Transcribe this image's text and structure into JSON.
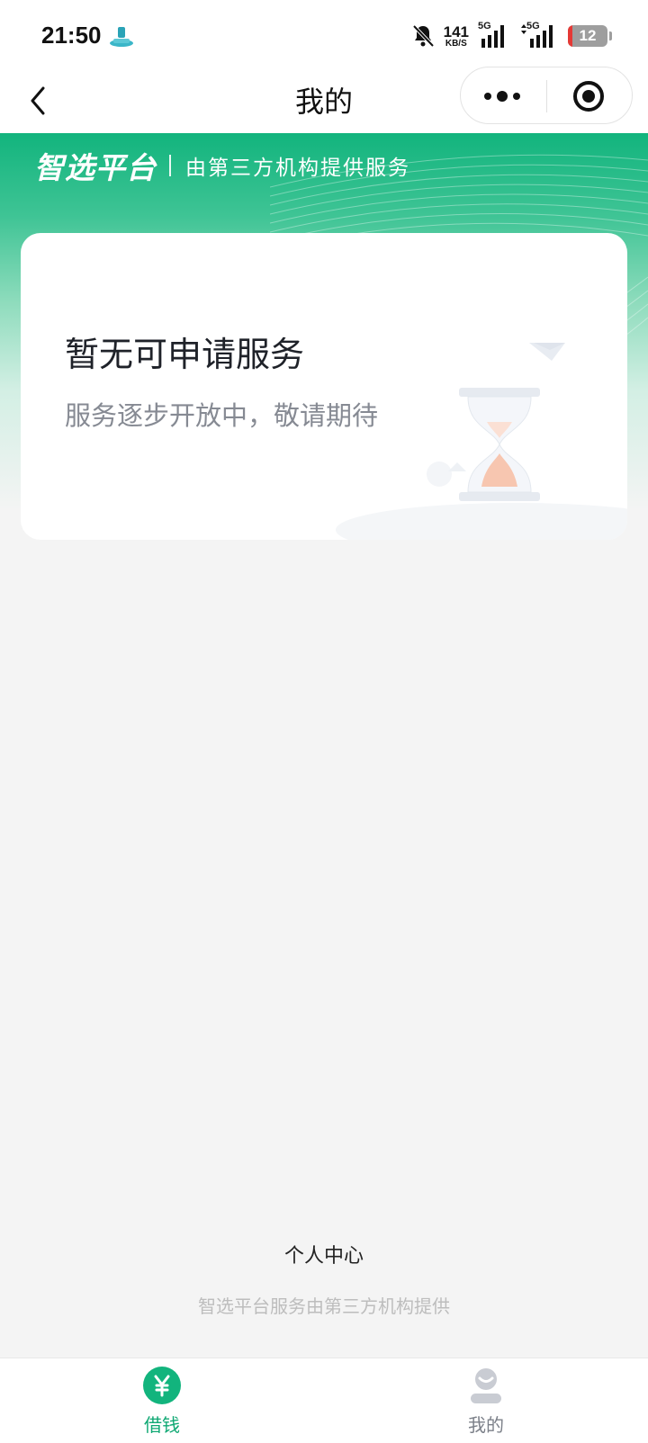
{
  "status_bar": {
    "time": "21:50",
    "net_speed": "141",
    "net_speed_unit": "KB/S",
    "signal_1": "5G",
    "signal_2": "5G",
    "battery": "12",
    "battery_level_percent": 12,
    "battery_color": "#e53935"
  },
  "nav": {
    "title": "我的",
    "back_icon": "chevron-left-icon",
    "more_icon": "more-dots-icon",
    "close_icon": "target-close-icon"
  },
  "brand": {
    "name": "智选平台",
    "subtitle": "由第三方机构提供服务",
    "accent": "#12b47d"
  },
  "card": {
    "title": "暂无可申请服务",
    "subtitle": "服务逐步开放中，敬请期待",
    "illustration": "hourglass-icon"
  },
  "footer": {
    "title": "个人中心",
    "note": "智选平台服务由第三方机构提供"
  },
  "tabs": [
    {
      "label": "借钱",
      "icon": "yuan-coin-icon",
      "active": true,
      "color": "#0fa873"
    },
    {
      "label": "我的",
      "icon": "user-avatar-icon",
      "active": false,
      "color": "#7c8089"
    }
  ]
}
